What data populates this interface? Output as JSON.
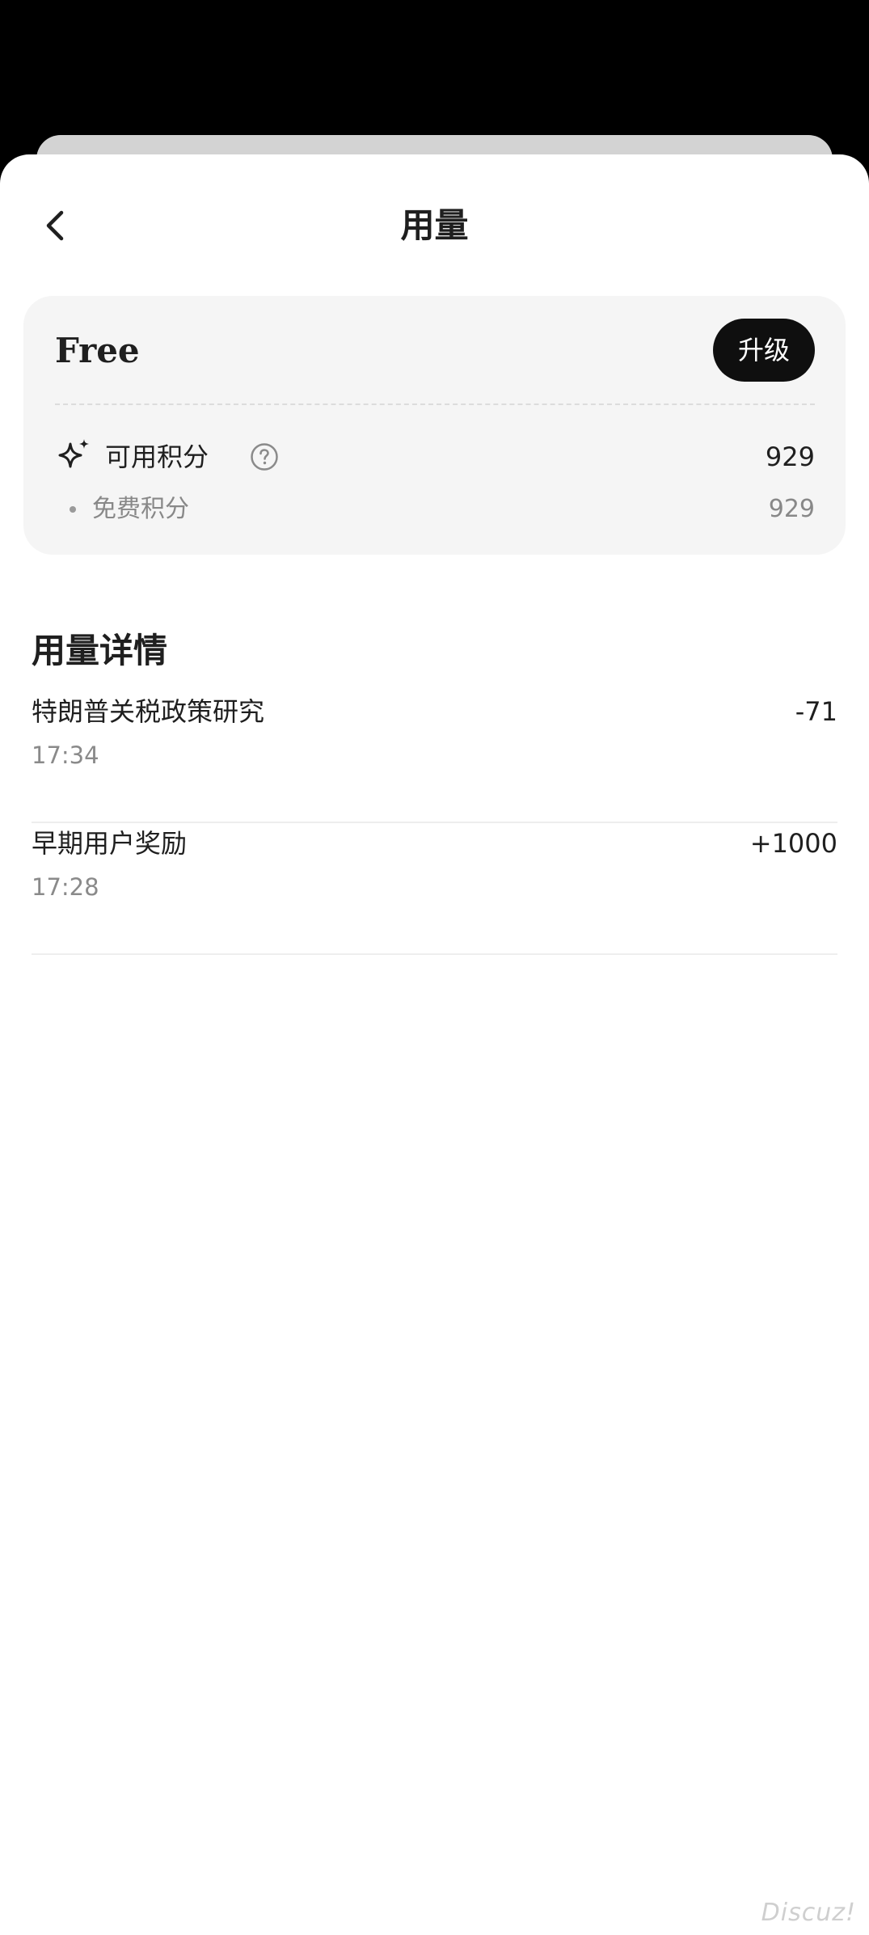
{
  "header": {
    "title": "用量",
    "back_icon": "chevron-left-icon"
  },
  "plan": {
    "name": "Free",
    "upgrade_label": "升级",
    "credits": {
      "icon": "sparkle-icon",
      "label": "可用积分",
      "help_icon": "question-circle-icon",
      "value": "929"
    },
    "sub_credits": [
      {
        "label": "免费积分",
        "value": "929"
      }
    ]
  },
  "usage_details": {
    "title": "用量详情",
    "items": [
      {
        "name": "特朗普关税政策研究",
        "time": "17:34",
        "amount": "-71"
      },
      {
        "name": "早期用户奖励",
        "time": "17:28",
        "amount": "+1000"
      }
    ]
  },
  "watermark": "Discuz!",
  "colors": {
    "background_dim": "#000000",
    "sheet": "#ffffff",
    "card": "#f5f5f5",
    "button": "#0f0f0f",
    "primary_text": "#1f1f1f",
    "secondary_text": "#888888"
  }
}
